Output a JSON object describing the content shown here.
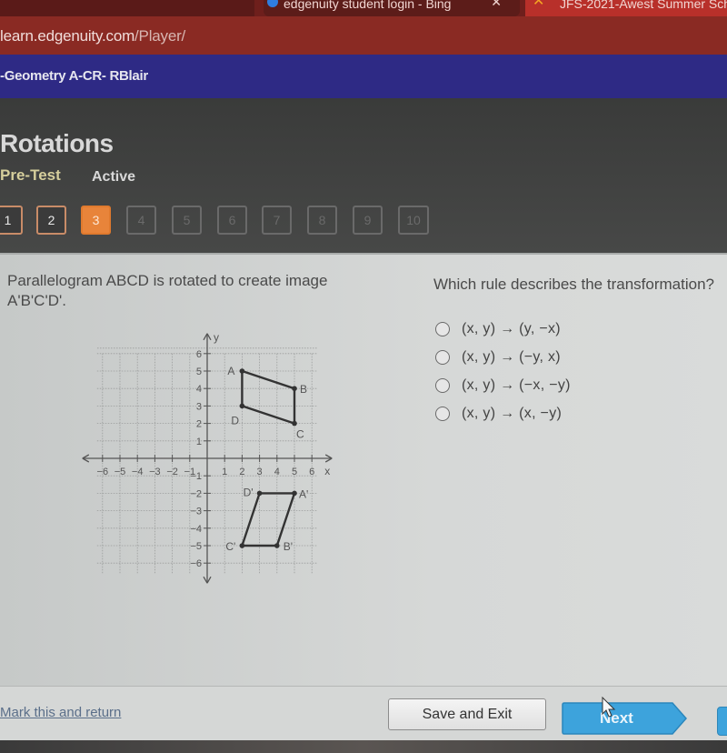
{
  "browser": {
    "tabs": [
      {
        "label": "",
        "state": "inactive"
      },
      {
        "label": "edgenuity student login - Bing",
        "state": "inactive",
        "favicon": "bing-icon"
      },
      {
        "label": "JFS-2021-Awest Summer Sch",
        "state": "active",
        "favicon": "edgenuity-icon"
      }
    ],
    "url_host": "learn.edgenuity.com",
    "url_path": "/Player/"
  },
  "course": {
    "title": "-Geometry A-CR- RBlair"
  },
  "lesson": {
    "title": "Rotations",
    "activity_type": "Pre-Test",
    "status": "Active",
    "questions": [
      {
        "label": "1",
        "state": "done"
      },
      {
        "label": "2",
        "state": "done"
      },
      {
        "label": "3",
        "state": "current"
      },
      {
        "label": "4",
        "state": "locked"
      },
      {
        "label": "5",
        "state": "locked"
      },
      {
        "label": "6",
        "state": "locked"
      },
      {
        "label": "7",
        "state": "locked"
      },
      {
        "label": "8",
        "state": "locked"
      },
      {
        "label": "9",
        "state": "locked"
      },
      {
        "label": "10",
        "state": "locked"
      }
    ]
  },
  "question": {
    "prompt": "Parallelogram ABCD is rotated to create image A'B'C'D'.",
    "text": "Which rule describes the transformation?",
    "options": [
      "(x, y) → (y, −x)",
      "(x, y) → (−y, x)",
      "(x, y) → (−x, −y)",
      "(x, y) → (x, −y)"
    ],
    "selected": null
  },
  "graph": {
    "x_axis_label": "x",
    "y_axis_label": "y",
    "x_range": [
      -6,
      6
    ],
    "y_range": [
      -6,
      6
    ],
    "x_ticks": [
      "-6",
      "-5",
      "-4",
      "-3",
      "-2",
      "-1",
      "1",
      "2",
      "3",
      "4",
      "5",
      "6"
    ],
    "y_ticks": [
      "6",
      "5",
      "4",
      "3",
      "2",
      "1",
      "-1",
      "-2",
      "-3",
      "-4",
      "-5",
      "-6"
    ],
    "original": {
      "name": "ABCD",
      "points": [
        {
          "label": "A",
          "x": 2,
          "y": 5
        },
        {
          "label": "B",
          "x": 5,
          "y": 4
        },
        {
          "label": "C",
          "x": 5,
          "y": 2
        },
        {
          "label": "D",
          "x": 2,
          "y": 3
        }
      ]
    },
    "image": {
      "name": "A'B'C'D'",
      "points": [
        {
          "label": "A'",
          "x": 5,
          "y": -2
        },
        {
          "label": "B'",
          "x": 4,
          "y": -5
        },
        {
          "label": "C'",
          "x": 2,
          "y": -5
        },
        {
          "label": "D'",
          "x": 3,
          "y": -2
        }
      ]
    }
  },
  "footer": {
    "mark_link": "Mark this and return",
    "save_exit": "Save and Exit",
    "next": "Next"
  },
  "colors": {
    "course_bar": "#2e2a85",
    "current_question": "#e8843a",
    "next_button": "#3da3dc",
    "browser_accent": "#b8302a"
  }
}
